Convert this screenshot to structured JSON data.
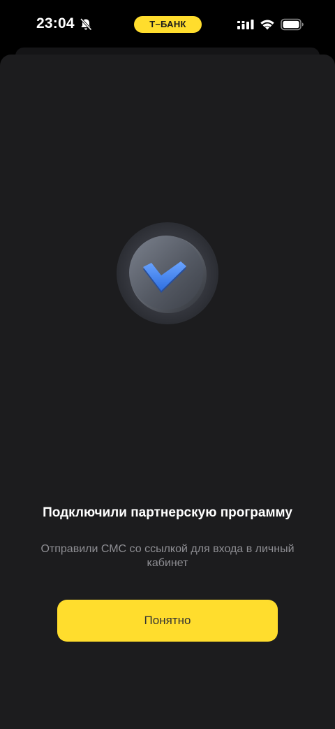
{
  "status_bar": {
    "time": "23:04",
    "bank_pill_label": "Т–БАНК",
    "icons": [
      "bell-slash-icon",
      "cellular-signal-icon",
      "wifi-icon",
      "battery-icon"
    ]
  },
  "dialog": {
    "icon": "checkmark-icon",
    "title": "Подключили партнерскую программу",
    "subtitle": "Отправили СМС со ссылкой для входа в личный кабинет",
    "confirm_button_label": "Понятно"
  },
  "colors": {
    "accent": "#ffdd2d",
    "sheet_background": "#1c1c1e",
    "page_background": "#000000",
    "checkmark": "#4b8af5",
    "subtitle_text": "#8e8e93"
  }
}
